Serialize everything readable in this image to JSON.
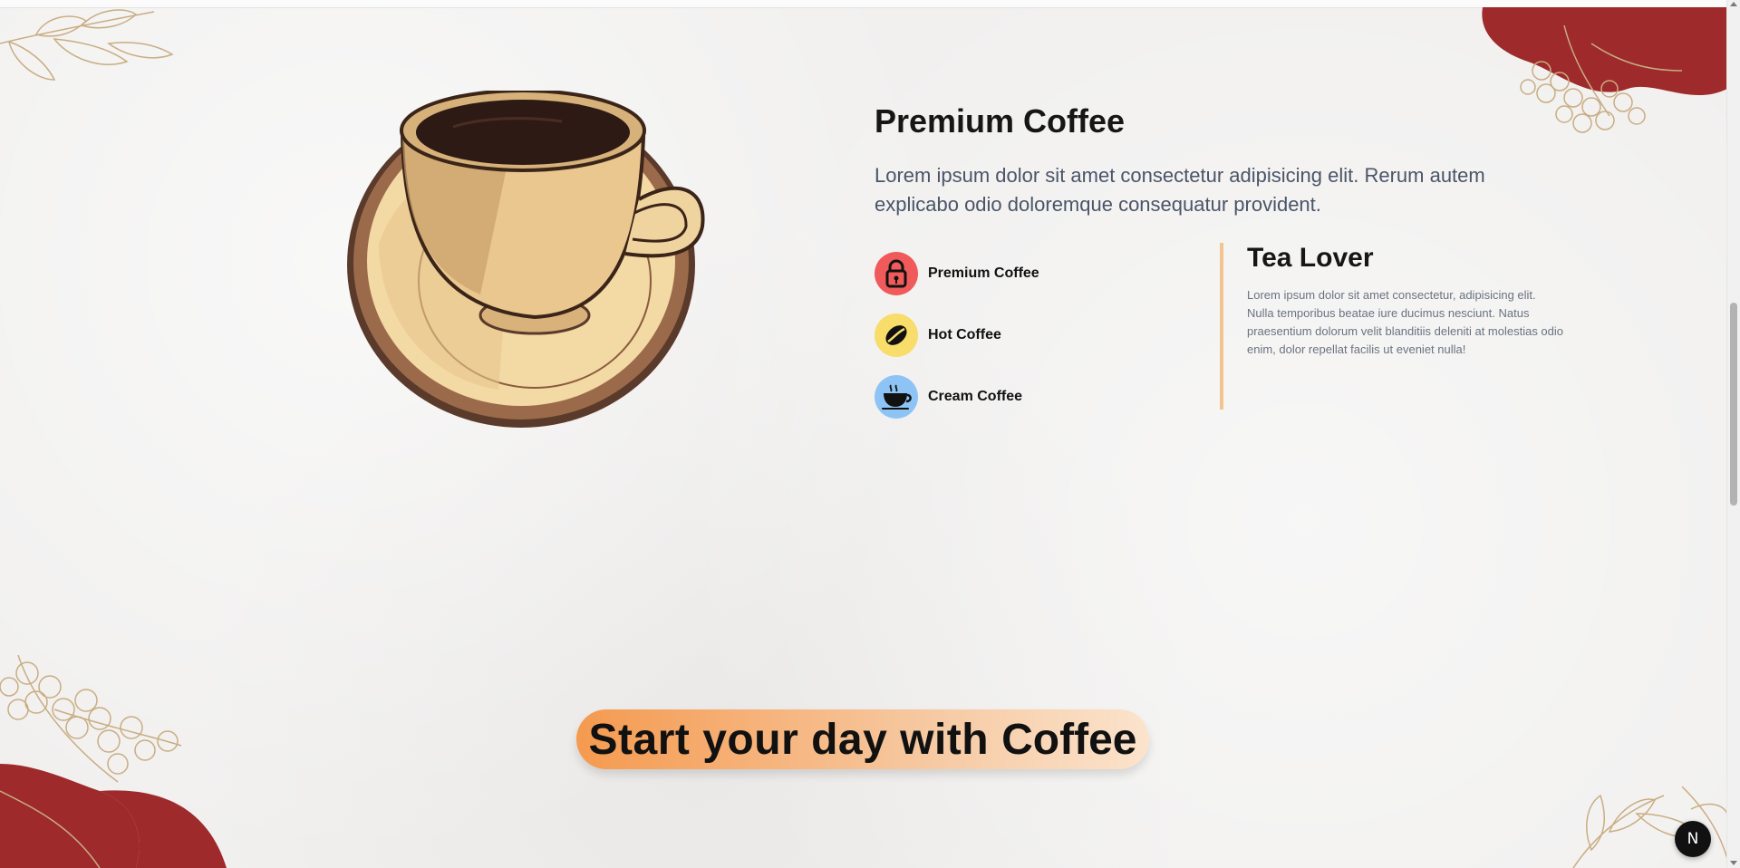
{
  "hero": {
    "title": "Premium Coffee",
    "lead": "Lorem ipsum dolor sit amet consectetur adipisicing elit. Rerum autem explicabo odio doloremque consequatur provident."
  },
  "features": [
    {
      "label": "Premium Coffee",
      "icon": "lock-icon",
      "color": "#f05a5a"
    },
    {
      "label": "Hot Coffee",
      "icon": "coffee-bean-icon",
      "color": "#f8dd6a"
    },
    {
      "label": "Cream Coffee",
      "icon": "coffee-cup-icon",
      "color": "#8ec4f5"
    }
  ],
  "tea": {
    "title": "Tea Lover",
    "text": "Lorem ipsum dolor sit amet consectetur, adipisicing elit. Nulla temporibus beatae iure ducimus nesciunt. Natus praesentium dolorum velit blanditiis deleniti at molestias odio enim, dolor repellat facilis ut eveniet nulla!"
  },
  "banner": {
    "prefix": "Start your day with",
    "emphasis": "Coffee"
  },
  "badge": {
    "letter": "N"
  },
  "colors": {
    "accent_orange": "#f59a4f",
    "tea_border": "#f2c48e",
    "deco_red": "#9e2a2b"
  }
}
